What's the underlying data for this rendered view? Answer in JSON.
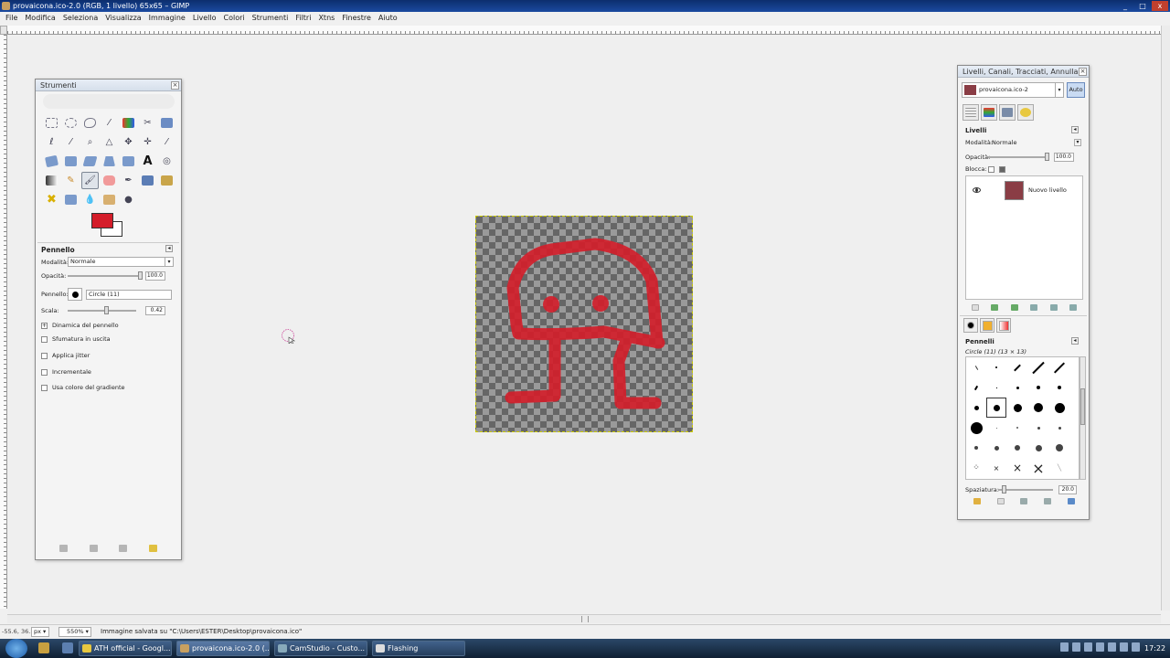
{
  "window": {
    "title": "provaicona.ico-2.0 (RGB, 1 livello) 65x65 – GIMP",
    "controls": [
      "_",
      "□",
      "x"
    ]
  },
  "menu": [
    "File",
    "Modifica",
    "Seleziona",
    "Visualizza",
    "Immagine",
    "Livello",
    "Colori",
    "Strumenti",
    "Filtri",
    "Xtns",
    "Finestre",
    "Aiuto"
  ],
  "toolbox": {
    "title": "Strumenti",
    "colors": {
      "foreground": "#d41d2a",
      "background": "#ffffff"
    },
    "options": {
      "title": "Pennello",
      "mode_label": "Modalità:",
      "mode_value": "Normale",
      "opacity_label": "Opacità:",
      "opacity_value": "100.0",
      "brush_label": "Pennello:",
      "brush_value": "Circle (11)",
      "scale_label": "Scala:",
      "scale_value": "0.42",
      "dynamics": "Dinamica del pennello",
      "checks": [
        "Sfumatura in uscita",
        "Applica jitter",
        "Incrementale",
        "Usa colore del gradiente"
      ]
    }
  },
  "canvas": {
    "image_colors": {
      "stroke": "#d41d2a",
      "checker_dark": "#666666",
      "checker_light": "#9a9a9a"
    }
  },
  "layers_dock": {
    "title": "Livelli, Canali, Tracciati, Annulla -",
    "image_name": "provaicona.ico-2",
    "auto_label": "Auto",
    "section": "Livelli",
    "mode_label": "Modalità:",
    "mode_value": "Normale",
    "opacity_label": "Opacità:",
    "opacity_value": "100.0",
    "lock_label": "Blocca:",
    "layer_name": "Nuovo livello",
    "brushes_title": "Pennelli",
    "brush_selected": "Circle (11) (13 × 13)",
    "spacing_label": "Spaziatura:",
    "spacing_value": "20.0"
  },
  "status": {
    "coords": "-55.6, 36.",
    "unit": "px",
    "zoom": "550%",
    "message": "Immagine salvata su \"C:\\Users\\ESTER\\Desktop\\provaicona.ico\""
  },
  "taskbar": {
    "buttons": [
      "ATH official - Googl...",
      "provaicona.ico-2.0 (...",
      "CamStudio - Custo...",
      "Flashing"
    ],
    "clock": "17:22"
  }
}
